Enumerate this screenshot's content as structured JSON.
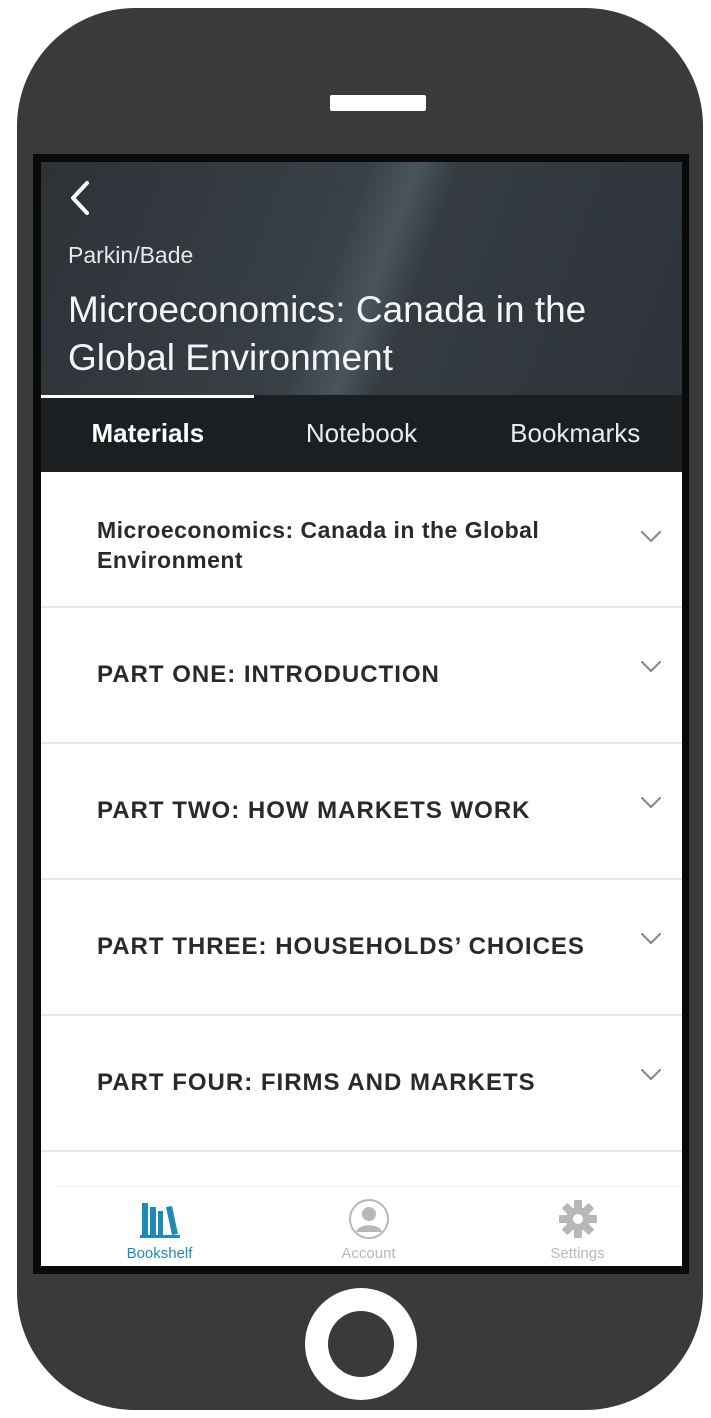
{
  "header": {
    "author": "Parkin/Bade",
    "title": "Microeconomics: Canada in the Global Environment"
  },
  "tabs": [
    {
      "label": "Materials",
      "active": true
    },
    {
      "label": "Notebook",
      "active": false
    },
    {
      "label": "Bookmarks",
      "active": false
    }
  ],
  "materials": [
    {
      "label": "Microeconomics: Canada in the Global Environment"
    },
    {
      "label": "PART ONE: INTRODUCTION"
    },
    {
      "label": "PART TWO: HOW MARKETS WORK"
    },
    {
      "label": "PART THREE: HOUSEHOLDS’ CHOICES"
    },
    {
      "label": "PART FOUR: FIRMS AND MARKETS"
    }
  ],
  "bottom_nav": [
    {
      "label": "Bookshelf",
      "icon": "bookshelf-icon",
      "active": true
    },
    {
      "label": "Account",
      "icon": "account-icon",
      "active": false
    },
    {
      "label": "Settings",
      "icon": "gear-icon",
      "active": false
    }
  ],
  "colors": {
    "accent": "#1e8bb5",
    "header_bg": "#2d3236",
    "tab_bar_bg": "#1b1f22",
    "phone_body": "#3a3a3a"
  }
}
